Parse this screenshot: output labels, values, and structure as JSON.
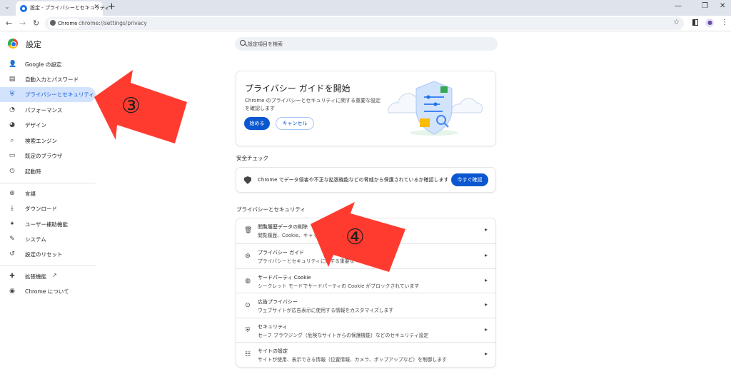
{
  "browser": {
    "tab_title": "設定 - プライバシーとセキュリティ",
    "tab_close": "✕",
    "new_tab": "+",
    "tab_search_icon": "chevron-down-icon",
    "window_controls": {
      "minimize": "—",
      "restore": "❐",
      "close": "✕"
    },
    "nav": {
      "back": "←",
      "forward": "→",
      "reload": "↻"
    },
    "site_chip": "Chrome",
    "url": "chrome://settings/privacy",
    "bookmark": "☆",
    "menu": "⋮"
  },
  "header": {
    "title": "設定",
    "search_placeholder": "設定項目を検索"
  },
  "sidebar": {
    "items": [
      {
        "label": "Google の設定",
        "icon": "person-icon",
        "glyph": "👤"
      },
      {
        "label": "自動入力とパスワード",
        "icon": "clipboard-icon",
        "glyph": "▤"
      },
      {
        "label": "プライバシーとセキュリティ",
        "icon": "shield-icon",
        "glyph": "⛨",
        "active": true
      },
      {
        "label": "パフォーマンス",
        "icon": "speedometer-icon",
        "glyph": "◔"
      },
      {
        "label": "デザイン",
        "icon": "palette-icon",
        "glyph": "◕"
      },
      {
        "label": "検索エンジン",
        "icon": "search-icon",
        "glyph": "⌕"
      },
      {
        "label": "既定のブラウザ",
        "icon": "browser-icon",
        "glyph": "▭"
      },
      {
        "label": "起動時",
        "icon": "power-icon",
        "glyph": "⏻"
      },
      {
        "label": "言語",
        "icon": "globe-icon",
        "glyph": "⊕"
      },
      {
        "label": "ダウンロード",
        "icon": "download-icon",
        "glyph": "⤓"
      },
      {
        "label": "ユーザー補助機能",
        "icon": "accessibility-icon",
        "glyph": "✦"
      },
      {
        "label": "システム",
        "icon": "wrench-icon",
        "glyph": "✎"
      },
      {
        "label": "設定のリセット",
        "icon": "reset-icon",
        "glyph": "↺"
      },
      {
        "label": "拡張機能",
        "icon": "puzzle-icon",
        "glyph": "✚"
      },
      {
        "label": "Chrome について",
        "icon": "chrome-icon",
        "glyph": "◉"
      }
    ],
    "external_link_icon": "↗"
  },
  "privacy_guide": {
    "title": "プライバシー ガイドを開始",
    "description": "Chrome のプライバシーとセキュリティに関する重要な設定を確認します",
    "start_button": "始める",
    "cancel_button": "キャンセル"
  },
  "safety_check": {
    "section_title": "安全チェック",
    "text": "Chrome でデータ侵害や不正な拡張機能などの脅威から保護されているか確認します",
    "button": "今すぐ確認"
  },
  "privacy_section": {
    "section_title": "プライバシーとセキュリティ",
    "rows": [
      {
        "title": "閲覧履歴データの削除",
        "subtitle": "閲覧履歴、Cookie、キャッ",
        "icon": "trash-icon",
        "glyph": "🗑"
      },
      {
        "title": "プライバシー ガイド",
        "subtitle": "プライバシーとセキュリティに関する重要な",
        "icon": "guide-icon",
        "glyph": "⊛"
      },
      {
        "title": "サードパーティ Cookie",
        "subtitle": "シークレット モードでサードパーティの Cookie がブロックされています",
        "icon": "cookie-icon",
        "glyph": "◍"
      },
      {
        "title": "広告プライバシー",
        "subtitle": "ウェブサイトが広告表示に使用する情報をカスタマイズします",
        "icon": "ads-icon",
        "glyph": "⊙"
      },
      {
        "title": "セキュリティ",
        "subtitle": "セーフ ブラウジング（危険なサイトからの保護機能）などのセキュリティ設定",
        "icon": "security-shield-icon",
        "glyph": "⛨"
      },
      {
        "title": "サイトの設定",
        "subtitle": "サイトが使用、表示できる情報（位置情報、カメラ、ポップアップなど）を制御します",
        "icon": "sliders-icon",
        "glyph": "☷"
      }
    ],
    "chevron": "▸"
  },
  "annotations": {
    "arrow_3": "③",
    "arrow_4": "④",
    "color": "#ff3b30"
  }
}
